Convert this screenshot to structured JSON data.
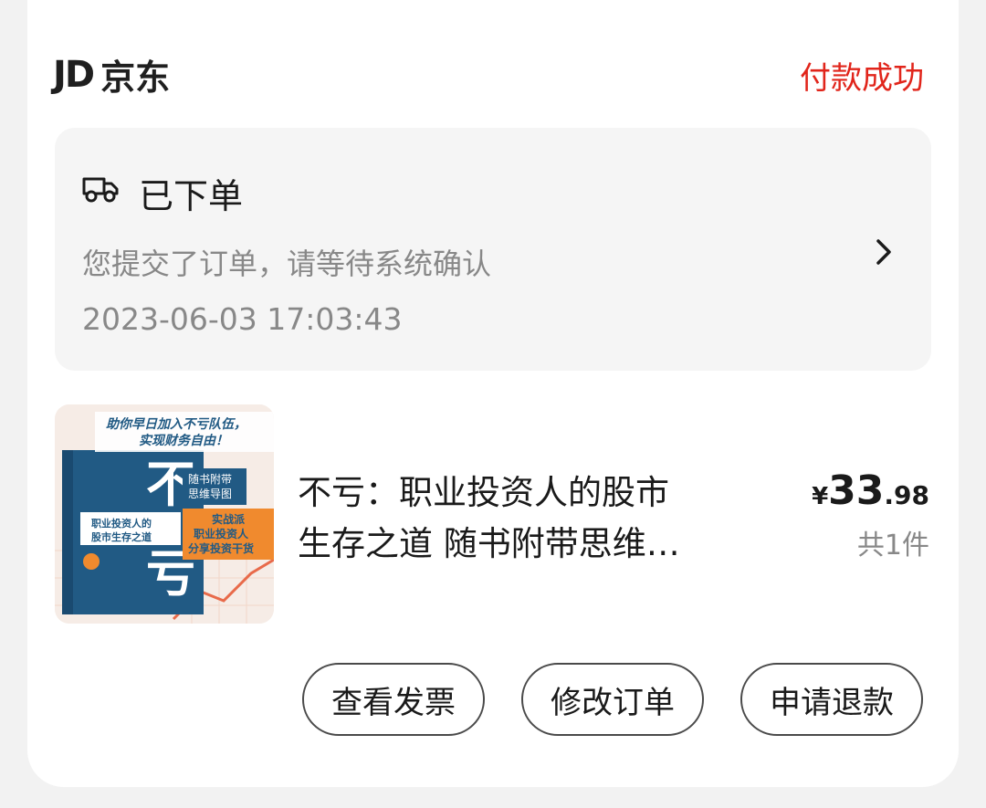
{
  "header": {
    "logo_jd": "JD",
    "logo_cn": "京东",
    "status": "付款成功",
    "status_color": "#e1251b"
  },
  "order_status": {
    "icon": "truck-icon",
    "title": "已下单",
    "description": "您提交了订单，请等待系统确认",
    "timestamp": "2023-06-03 17:03:43"
  },
  "product": {
    "title_line1": "不亏：职业投资人的股市",
    "title_line2": "生存之道  随书附带思维…",
    "price_currency": "¥",
    "price_int": "33",
    "price_dec": ".98",
    "quantity": "共1件",
    "cover": {
      "banner_line1": "助你早日加入不亏队伍，",
      "banner_line2": "实现财务自由！",
      "big_char1": "不",
      "big_char2": "亏",
      "subtitle1": "职业投资人的",
      "subtitle2": "股市生存之道",
      "sticker1": "随书附带",
      "sticker2": "思维导图",
      "promo1": "实战派",
      "promo2": "职业投资人",
      "promo3": "分享投资干货"
    }
  },
  "actions": {
    "view_invoice": "查看发票",
    "modify_order": "修改订单",
    "request_refund": "申请退款"
  }
}
